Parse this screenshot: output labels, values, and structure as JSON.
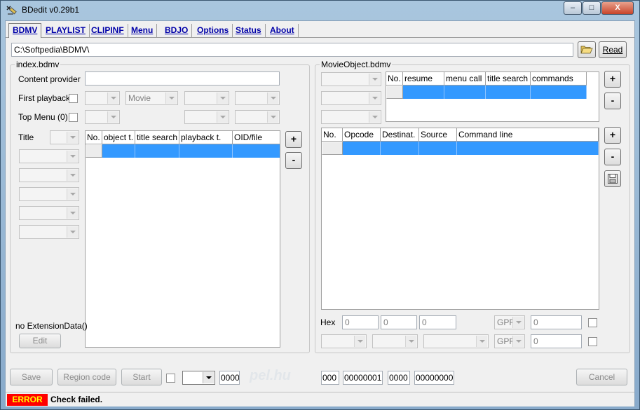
{
  "window": {
    "title": "BDedit v0.29b1",
    "controls": {
      "minimize": "–",
      "maximize": "□",
      "close": "X"
    }
  },
  "tabs": [
    {
      "label": "BDMV",
      "active": true
    },
    {
      "label": "PLAYLIST"
    },
    {
      "label": "CLIPINF"
    },
    {
      "label": "Menu"
    },
    {
      "label": "BDJO"
    },
    {
      "label": "Options"
    },
    {
      "label": "Status"
    },
    {
      "label": "About"
    }
  ],
  "path": {
    "value": "C:\\Softpedia\\BDMV\\",
    "read_label": "Read",
    "folder_icon": "folder-open-icon"
  },
  "index": {
    "legend": "index.bdmv",
    "content_provider_label": "Content provider",
    "content_provider_value": "",
    "first_playback_label": "First playback",
    "first_playback_type": "Movie",
    "top_menu_label": "Top Menu (0)",
    "title_label": "Title",
    "grid": {
      "columns": [
        "No.",
        "object t.",
        "title search",
        "playback t.",
        "OID/file"
      ]
    },
    "no_extension_label": "no ExtensionData()",
    "edit_label": "Edit",
    "add_label": "+",
    "remove_label": "-"
  },
  "movie_object": {
    "legend": "MovieObject.bdmv",
    "top_grid": {
      "columns": [
        "No.",
        "resume",
        "menu call",
        "title search",
        "commands"
      ]
    },
    "cmd_grid": {
      "columns": [
        "No.",
        "Opcode",
        "Destinat.",
        "Source",
        "Command line"
      ]
    },
    "hex_label": "Hex",
    "hex_values": [
      "0",
      "0",
      "0"
    ],
    "gpr_label": "GPR",
    "gpr_value_1": "0",
    "gpr_value_2": "0",
    "add_label": "+",
    "remove_label": "-",
    "save_icon": "floppy-disk-icon"
  },
  "bottom": {
    "save_label": "Save",
    "region_code_label": "Region code",
    "start_label": "Start",
    "value_0000": "0000",
    "watermark": "pel.hu",
    "value_000": "000",
    "value_00000001": "00000001",
    "value_0000b": "0000",
    "value_00000000": "00000000",
    "cancel_label": "Cancel"
  },
  "status": {
    "badge": "ERROR",
    "message": "Check failed.",
    "badge_color": "#ff0000"
  }
}
